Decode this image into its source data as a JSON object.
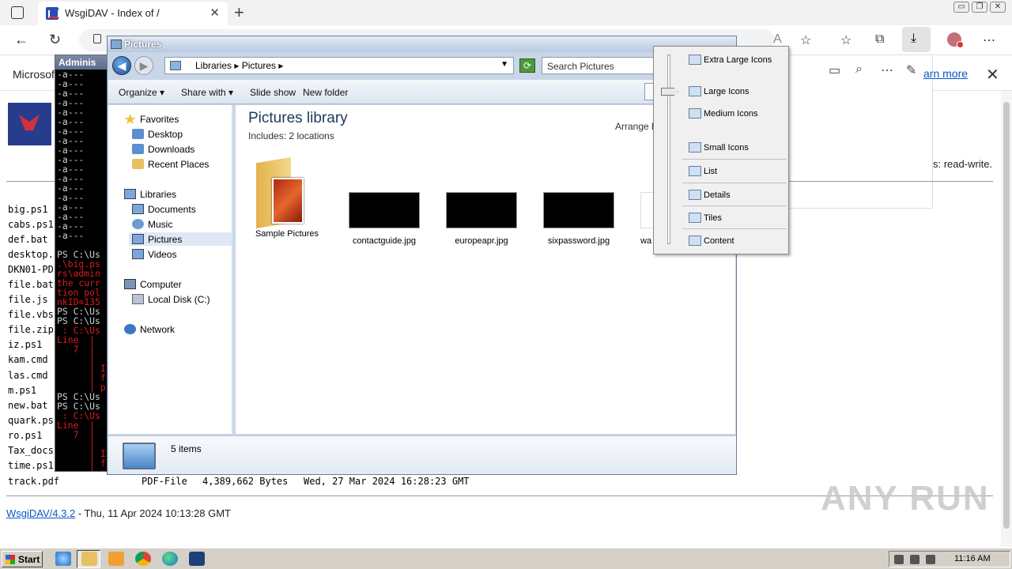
{
  "browser": {
    "tab_title": "WsgiDAV - Index of /",
    "tab_close": "✕",
    "new_tab": "+",
    "window_buttons": [
      "▭",
      "❐",
      "✕"
    ],
    "icons": [
      "back-icon",
      "refresh-icon",
      "lock-icon",
      "read-aloud-icon",
      "add-favorite-icon",
      "favorites-icon",
      "collections-icon",
      "download-icon",
      "profile-icon",
      "more-icon"
    ],
    "strip_label": "Microsof",
    "learn_more": "arn more",
    "strip_close": "✕"
  },
  "page": {
    "permissions": "s: read-write.",
    "files": [
      "big.ps1",
      "cabs.ps1",
      "def.bat",
      "desktop.",
      "DKN01-PD",
      "file.bat",
      "file.js",
      "file.vbs",
      "file.zip",
      "iz.ps1",
      "kam.cmd",
      "las.cmd",
      "m.ps1",
      "new.bat",
      "quark.ps",
      "ro.ps1",
      "Tax_docs",
      "time.ps1"
    ],
    "last_row": {
      "name": "track.pdf",
      "type": "PDF-File",
      "size": "4,389,662 Bytes",
      "date": "Wed, 27 Mar 2024 16:28:23 GMT"
    },
    "footer_link": "WsgiDAV/4.3.2",
    "footer_text": " - Thu, 11 Apr 2024 10:13:28 GMT",
    "watermark": "ANY RUN"
  },
  "powershell": {
    "title": "Adminis",
    "lines": [
      {
        "t": "-a---",
        "c": "w"
      },
      {
        "t": "-a---",
        "c": "w"
      },
      {
        "t": "-a---",
        "c": "w"
      },
      {
        "t": "-a---",
        "c": "w"
      },
      {
        "t": "-a---",
        "c": "w"
      },
      {
        "t": "-a---",
        "c": "w"
      },
      {
        "t": "-a---",
        "c": "w"
      },
      {
        "t": "-a---",
        "c": "w"
      },
      {
        "t": "-a---",
        "c": "w"
      },
      {
        "t": "-a---",
        "c": "w"
      },
      {
        "t": "-a---",
        "c": "w"
      },
      {
        "t": "-a---",
        "c": "w"
      },
      {
        "t": "-a---",
        "c": "w"
      },
      {
        "t": "-a---",
        "c": "w"
      },
      {
        "t": "-a---",
        "c": "w"
      },
      {
        "t": "-a---",
        "c": "w"
      },
      {
        "t": "-a---",
        "c": "w"
      },
      {
        "t": "-a---",
        "c": "w"
      },
      {
        "t": "",
        "c": "w"
      },
      {
        "t": "PS C:\\Us",
        "c": "w"
      },
      {
        "t": ".\\big.ps",
        "c": "r"
      },
      {
        "t": "rs\\admin",
        "c": "r"
      },
      {
        "t": "the curr",
        "c": "r"
      },
      {
        "t": "tion pol",
        "c": "r"
      },
      {
        "t": "nkID=135",
        "c": "r"
      },
      {
        "t": "PS C:\\Us",
        "c": "w"
      },
      {
        "t": "PS C:\\Us",
        "c": "w"
      },
      {
        "t": " : C:\\Us",
        "c": "r"
      },
      {
        "t": "Line  |",
        "c": "r"
      },
      {
        "t": "   7  |",
        "c": "r"
      },
      {
        "t": "      |",
        "c": "r"
      },
      {
        "t": "      | I",
        "c": "r"
      },
      {
        "t": "      | f",
        "c": "r"
      },
      {
        "t": "      | p",
        "c": "r"
      },
      {
        "t": "PS C:\\Us",
        "c": "w"
      },
      {
        "t": "PS C:\\Us",
        "c": "w"
      },
      {
        "t": " : C:\\Us",
        "c": "r"
      },
      {
        "t": "Line  |",
        "c": "r"
      },
      {
        "t": "   7  |",
        "c": "r"
      },
      {
        "t": "      |",
        "c": "r"
      },
      {
        "t": "      | I",
        "c": "r"
      },
      {
        "t": "      | f",
        "c": "r"
      },
      {
        "t": "      | p",
        "c": "r"
      },
      {
        "t": "PS C:\\Us",
        "c": "w"
      }
    ]
  },
  "explorer": {
    "title": "Pictures",
    "breadcrumb": "Libraries  ▸  Pictures  ▸",
    "search_placeholder": "Search Pictures",
    "commands": [
      "Organize  ▾",
      "Share with  ▾",
      "Slide show",
      "New folder"
    ],
    "nav": {
      "favorites": "Favorites",
      "desktop": "Desktop",
      "downloads": "Downloads",
      "recent": "Recent Places",
      "libraries": "Libraries",
      "documents": "Documents",
      "music": "Music",
      "pictures": "Pictures",
      "videos": "Videos",
      "computer": "Computer",
      "local_disk": "Local Disk (C:)",
      "network": "Network"
    },
    "library_title": "Pictures library",
    "library_sub": "Includes:  2 locations",
    "arrange_by": "Arrange b",
    "items": [
      "Sample Pictures",
      "contactguide.jpg",
      "europeapr.jpg",
      "sixpassword.jpg",
      "wa"
    ],
    "status": "5 items"
  },
  "view_menu": {
    "items": [
      "Extra Large Icons",
      "Large Icons",
      "Medium Icons",
      "Small Icons",
      "List",
      "Details",
      "Tiles",
      "Content"
    ],
    "selected": "Large Icons"
  },
  "taskbar": {
    "start": "Start",
    "clock": "11:16 AM",
    "icons": [
      "ie-icon",
      "explorer-icon",
      "media-player-icon",
      "chrome-icon",
      "edge-icon",
      "powershell-icon"
    ]
  }
}
